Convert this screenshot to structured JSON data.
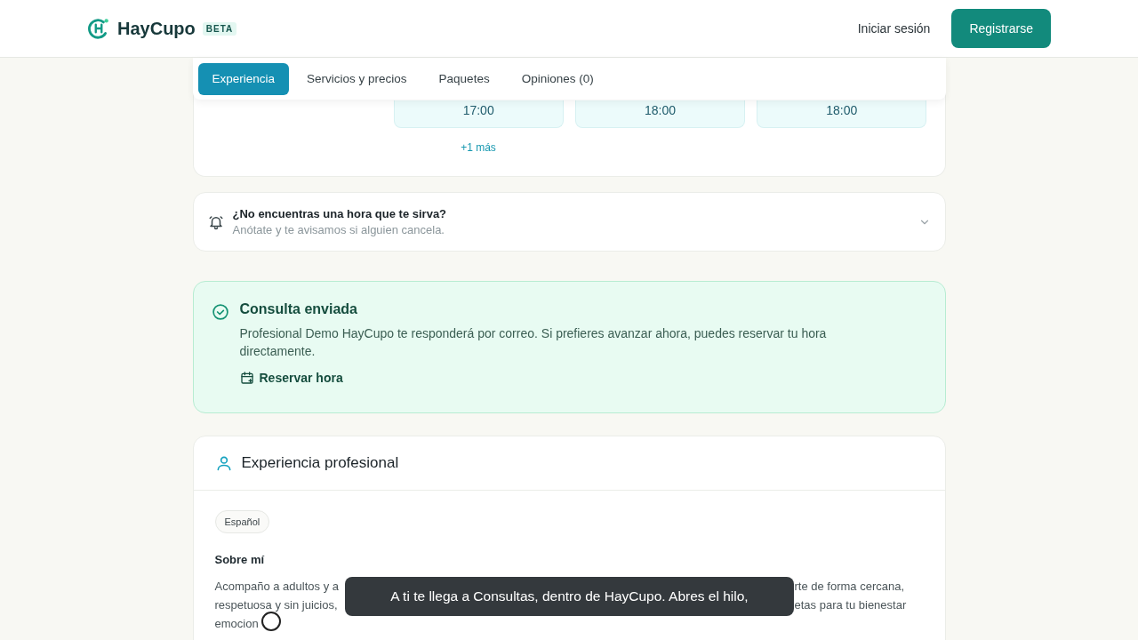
{
  "header": {
    "logo_text": "HayCupo",
    "badge": "BETA",
    "login": "Iniciar sesión",
    "register": "Registrarse"
  },
  "tabs": [
    {
      "label": "Experiencia",
      "selected": true
    },
    {
      "label": "Servicios y precios",
      "selected": false
    },
    {
      "label": "Paquetes",
      "selected": false
    },
    {
      "label": "Opiniones (0)",
      "selected": false
    }
  ],
  "time_slots": [
    "17:00",
    "18:00",
    "18:00"
  ],
  "more_link": "+1 más",
  "waitlist": {
    "title": "¿No encuentras una hora que te sirva?",
    "subtitle": "Anótate y te avisamos si alguien cancela.",
    "expanded": false
  },
  "notice": {
    "title": "Consulta enviada",
    "message": "Profesional Demo HayCupo te responderá por correo. Si prefieres avanzar ahora, puedes reservar tu hora directamente.",
    "action": "Reservar hora"
  },
  "experience": {
    "title": "Experiencia profesional",
    "languages": [
      "Español"
    ],
    "about_title": "Sobre mí",
    "about_lines": [
      {
        "before": "Acompaño a adultos y a",
        "after": "rte de forma cercana,"
      },
      {
        "before": "respetuosa y sin juicios,",
        "after": "etas para tu bienestar"
      },
      {
        "before": "emocion"
      }
    ]
  },
  "caption": "A ti te llega a Consultas, dentro de HayCupo. Abres el hilo,"
}
